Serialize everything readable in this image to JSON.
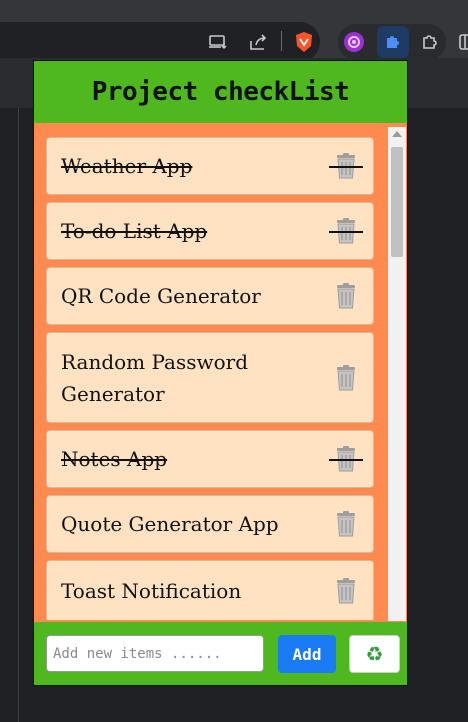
{
  "colors": {
    "header_bg": "#4fb81e",
    "list_bg": "#ff8a4f",
    "item_bg": "#ffe2c2",
    "add_button_bg": "#1a7cf5"
  },
  "toolbar": {
    "icons": [
      "screen-cast-icon",
      "share-icon",
      "brave-shields-icon",
      "extension-purple-icon",
      "puzzle-extension-icon",
      "extensions-icon",
      "side-panel-icon"
    ]
  },
  "popup": {
    "title": "Project checkList",
    "items": [
      {
        "text": "Weather App",
        "done": true
      },
      {
        "text": "To-do List App",
        "done": true
      },
      {
        "text": "QR Code Generator",
        "done": false
      },
      {
        "text": "Random Password Generator",
        "done": false
      },
      {
        "text": "Notes App",
        "done": true
      },
      {
        "text": "Quote Generator App",
        "done": false
      },
      {
        "text": "Toast Notification",
        "done": false
      }
    ],
    "input_placeholder": "Add new items ......",
    "add_label": "Add",
    "clear_icon": "♻"
  }
}
